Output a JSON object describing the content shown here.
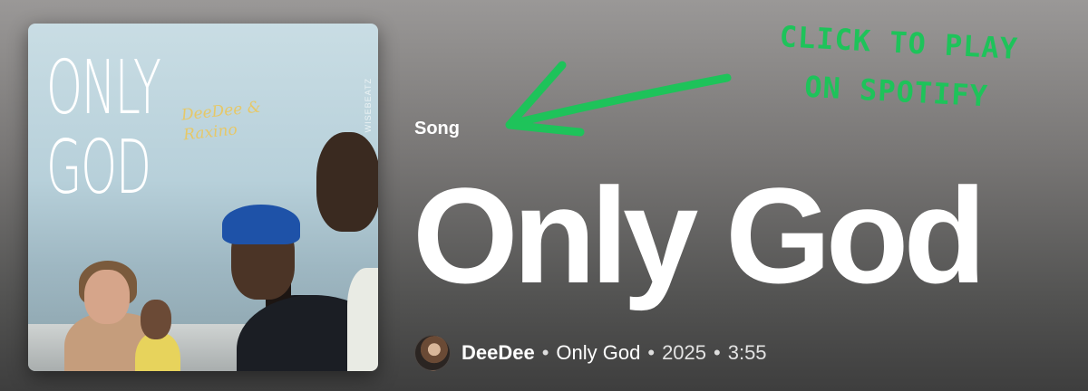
{
  "cover": {
    "title_line1": "ONLY",
    "title_line2": "GOD",
    "artists_line1": "DeeDee &",
    "artists_line2": "Raxino",
    "producer": "WISEBEATZ"
  },
  "header": {
    "type_label": "Song",
    "title": "Only God"
  },
  "meta": {
    "artist": "DeeDee",
    "album": "Only God",
    "year": "2025",
    "duration": "3:55",
    "separator": "•"
  },
  "annotation": {
    "line1": "Click to play",
    "line2": "on Spotify",
    "color": "#1ec35a"
  }
}
